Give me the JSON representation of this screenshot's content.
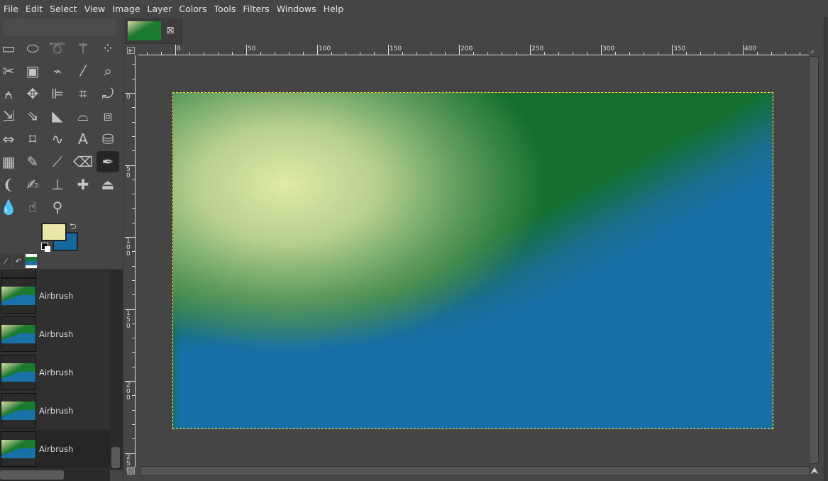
{
  "menu": [
    "File",
    "Edit",
    "Select",
    "View",
    "Image",
    "Layer",
    "Colors",
    "Tools",
    "Filters",
    "Windows",
    "Help"
  ],
  "tools": [
    [
      "rect-select-icon",
      "▭"
    ],
    [
      "ellipse-select-icon",
      "⬭"
    ],
    [
      "free-select-icon",
      "➰"
    ],
    [
      "fuzzy-select-icon",
      "⚚"
    ],
    [
      "select-by-color-icon",
      "⁘"
    ],
    [
      "scissors-icon",
      "✂"
    ],
    [
      "foreground-select-icon",
      "▣"
    ],
    [
      "paths-icon",
      "⌁"
    ],
    [
      "color-picker-icon",
      "⁄"
    ],
    [
      "zoom-icon",
      "⌕"
    ],
    [
      "measure-icon",
      "⍲"
    ],
    [
      "move-icon",
      "✥"
    ],
    [
      "align-icon",
      "⊫"
    ],
    [
      "crop-icon",
      "⌗"
    ],
    [
      "rotate-icon",
      "⤾"
    ],
    [
      "scale-icon",
      "⇲"
    ],
    [
      "shear-icon",
      "⇘"
    ],
    [
      "perspective-icon",
      "◣"
    ],
    [
      "3d-transform-icon",
      "⌓"
    ],
    [
      "cage-icon",
      "⧈"
    ],
    [
      "flip-icon",
      "⇔"
    ],
    [
      "unified-transform-icon",
      "⌑"
    ],
    [
      "warp-icon",
      "∿"
    ],
    [
      "text-icon",
      "A"
    ],
    [
      "bucket-fill-icon",
      "⛁"
    ],
    [
      "gradient-icon",
      "▦"
    ],
    [
      "pencil-icon",
      "✎"
    ],
    [
      "paintbrush-icon",
      "⟋"
    ],
    [
      "eraser-icon",
      "⌫"
    ],
    [
      "airbrush-icon",
      "✒"
    ],
    [
      "ink-icon",
      "❨"
    ],
    [
      "mypaint-brush-icon",
      "✍"
    ],
    [
      "clone-icon",
      "⊥"
    ],
    [
      "heal-icon",
      "✚"
    ],
    [
      "perspective-clone-icon",
      "⏏"
    ],
    [
      "blur-icon",
      "💧"
    ],
    [
      "smudge-icon",
      "☝"
    ],
    [
      "dodge-burn-icon",
      "⚲"
    ]
  ],
  "active_tool": 29,
  "colors": {
    "foreground": "#e8e6a8",
    "background": "#1668a0"
  },
  "dock_tabs": [
    "tool-options-icon",
    "undo-history-icon",
    "images-icon"
  ],
  "history": [
    "Airbrush",
    "Airbrush",
    "Airbrush",
    "Airbrush",
    "Airbrush"
  ],
  "hruler": [
    "0",
    "50",
    "100",
    "150",
    "200",
    "250",
    "300",
    "350",
    "400"
  ],
  "vruler": [
    "0",
    "50",
    "100",
    "150",
    "200",
    "250"
  ],
  "image_tab_close": "⊠"
}
